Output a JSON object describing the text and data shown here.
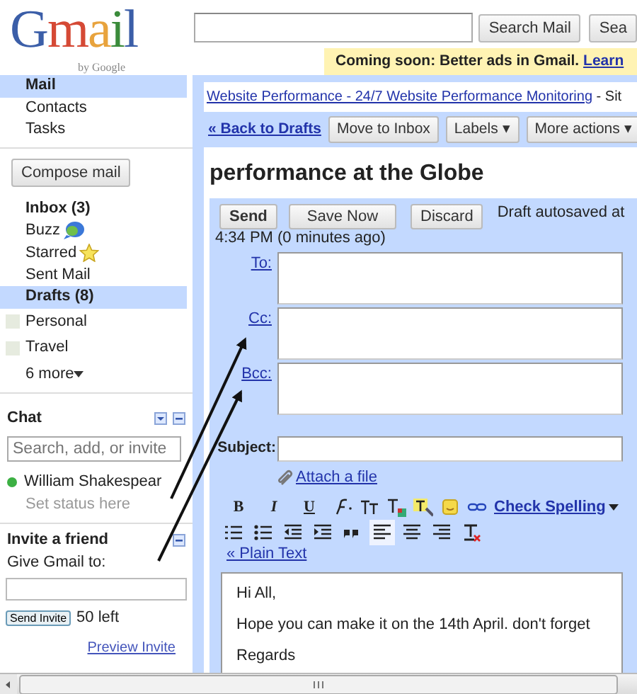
{
  "logo": {
    "letters": [
      "G",
      "m",
      "a",
      "i",
      "l"
    ],
    "subtext": "by Google"
  },
  "search": {
    "buttons": [
      "Search Mail",
      "Sea"
    ]
  },
  "banner": {
    "text": "Coming soon: Better ads in Gmail.",
    "link": "Learn"
  },
  "nav": [
    {
      "label": "Mail",
      "selected": true
    },
    {
      "label": "Contacts",
      "selected": false
    },
    {
      "label": "Tasks",
      "selected": false
    }
  ],
  "compose_button": "Compose mail",
  "folders": [
    {
      "label": "Inbox (3)",
      "unread": true,
      "selected": false
    },
    {
      "label": "Buzz",
      "unread": false,
      "selected": false,
      "kind": "buzz"
    },
    {
      "label": "Starred",
      "unread": false,
      "selected": false,
      "kind": "starred"
    },
    {
      "label": "Sent Mail",
      "unread": false,
      "selected": false
    },
    {
      "label": "Drafts (8)",
      "unread": true,
      "selected": true
    }
  ],
  "labels": [
    "Personal",
    "Travel"
  ],
  "more_labels": "6 more",
  "chat": {
    "title": "Chat",
    "search_placeholder": "Search, add, or invite",
    "contacts": [
      {
        "name": "William Shakespear",
        "online": true
      }
    ],
    "status": "Set status here"
  },
  "invite": {
    "title": "Invite a friend",
    "prompt": "Give Gmail to:",
    "button": "Send Invite",
    "remaining": "50 left",
    "preview": "Preview Invite"
  },
  "main": {
    "sponsored_link": "Website Performance - 24/7 Website Performance Monitoring",
    "sponsored_rest": "- Sit",
    "back_link": "« Back to Drafts",
    "toolbar": [
      "Move to Inbox",
      "Labels ▾",
      "More actions ▾"
    ],
    "title": "performance at the Globe"
  },
  "compose": {
    "buttons": [
      {
        "label": "Send",
        "bold": true
      },
      {
        "label": "Save Now",
        "bold": false
      },
      {
        "label": "Discard",
        "bold": false
      }
    ],
    "autosave": "Draft autosaved at",
    "autosave_time": "4:34 PM (0 minutes ago)",
    "recipients": [
      "To:",
      "Cc:",
      "Bcc:"
    ],
    "subject_label": "Subject:",
    "attach": "Attach a file",
    "format_row_1": [
      {
        "kind": "bold",
        "label": "B"
      },
      {
        "kind": "italic",
        "label": "I"
      },
      {
        "kind": "underline",
        "label": "U"
      },
      {
        "kind": "font"
      },
      {
        "kind": "size"
      },
      {
        "kind": "text-color"
      },
      {
        "kind": "highlight"
      },
      {
        "kind": "emoji"
      },
      {
        "kind": "link"
      }
    ],
    "check_spelling": "Check Spelling",
    "format_row_2": [
      {
        "kind": "numbered-list",
        "selected": false
      },
      {
        "kind": "bullet-list",
        "selected": false
      },
      {
        "kind": "outdent",
        "selected": false
      },
      {
        "kind": "indent",
        "selected": false
      },
      {
        "kind": "quote",
        "selected": false
      },
      {
        "kind": "align-left",
        "selected": true
      },
      {
        "kind": "align-center",
        "selected": false
      },
      {
        "kind": "align-right",
        "selected": false
      },
      {
        "kind": "clear-format",
        "selected": false
      }
    ],
    "plain_text": "« Plain Text",
    "body": [
      "Hi All,",
      "Hope you can make it on the 14th April. don't forget",
      "Regards"
    ]
  }
}
